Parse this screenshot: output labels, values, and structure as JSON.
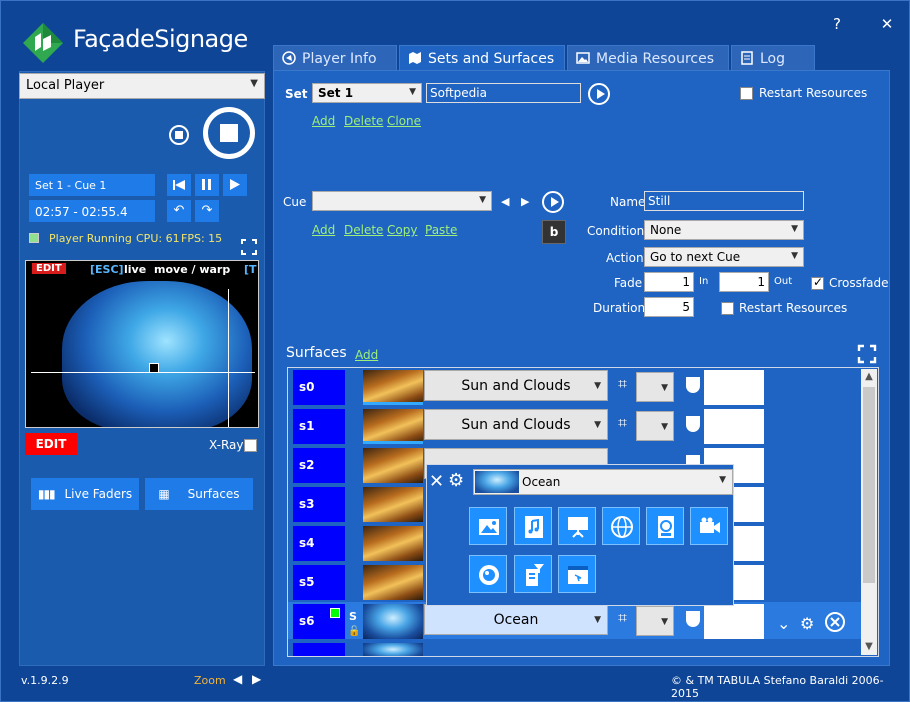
{
  "app": {
    "logo_text": "FaçadeSignage",
    "help_label": "?",
    "close_label": "✕"
  },
  "left": {
    "player_select": "Local Player",
    "cue_info": "Set 1 - Cue 1",
    "time_info": "02:57 - 02:55.4",
    "status": "Player Running",
    "cpu": "CPU: 61",
    "fps": "FPS: 15",
    "preview": {
      "edit_badge": "EDIT",
      "esc_label": "[ESC]",
      "live_label": "live",
      "move_warp_label": "move / warp",
      "t_label": "[T"
    },
    "edit_button": "EDIT",
    "xray_label": "X-Ray",
    "live_faders_button": "Live Faders",
    "surfaces_button": "Surfaces"
  },
  "footer": {
    "version": "v.1.9.2.9",
    "zoom_label": "Zoom",
    "copyright": "© & TM TABULA Stefano Baraldi 2006-2015"
  },
  "tabs": [
    {
      "label": "Player Info"
    },
    {
      "label": "Sets and Surfaces"
    },
    {
      "label": "Media Resources"
    },
    {
      "label": "Log"
    }
  ],
  "set_section": {
    "label": "Set",
    "selected": "Set 1",
    "name_value": "Softpedia",
    "restart_label": "Restart Resources",
    "links": {
      "add": "Add",
      "delete": "Delete",
      "clone": "Clone"
    }
  },
  "cue_section": {
    "label": "Cue",
    "selected": "",
    "b_button": "b",
    "links": {
      "add": "Add",
      "delete": "Delete",
      "copy": "Copy",
      "paste": "Paste"
    },
    "name_label": "Name",
    "name_value": "Still",
    "condition_label": "Condition",
    "condition_value": "None",
    "action_label": "Action",
    "action_value": "Go to next Cue",
    "fade_label": "Fade",
    "fade_in_value": "1",
    "in_label": "In",
    "fade_out_value": "1",
    "out_label": "Out",
    "crossfade_label": "Crossfade",
    "duration_label": "Duration",
    "duration_value": "5",
    "restart_label": "Restart Resources"
  },
  "surfaces": {
    "title": "Surfaces",
    "add_link": "Add",
    "rows": [
      {
        "id": "s0",
        "media": "Sun and Clouds"
      },
      {
        "id": "s1",
        "media": "Sun and Clouds"
      },
      {
        "id": "s2",
        "media": ""
      },
      {
        "id": "s3",
        "media": ""
      },
      {
        "id": "s4",
        "media": ""
      },
      {
        "id": "s5",
        "media": ""
      },
      {
        "id": "s6",
        "media": "Ocean",
        "s_badge": "S"
      }
    ]
  },
  "popup": {
    "selected_media": "Ocean"
  }
}
